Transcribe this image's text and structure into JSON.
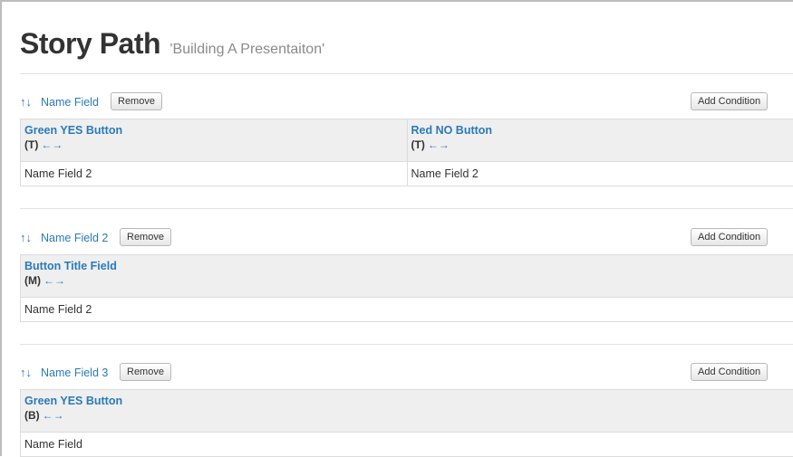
{
  "page": {
    "title": "Story Path",
    "subtitle": "'Building A Presentaiton'"
  },
  "icons": {
    "up_down": "↑↓",
    "left_right": "←→"
  },
  "sections": [
    {
      "name": "Name Field",
      "remove_label": "Remove",
      "add_condition_label": "Add Condition",
      "columns": [
        {
          "title": "Green YES Button",
          "tag": "(T)",
          "value": "Name Field 2"
        },
        {
          "title": "Red NO Button",
          "tag": "(T)",
          "value": "Name Field 2"
        }
      ]
    },
    {
      "name": "Name Field 2",
      "remove_label": "Remove",
      "add_condition_label": "Add Condition",
      "columns": [
        {
          "title": "Button Title Field",
          "tag": "(M)",
          "value": "Name Field 2"
        }
      ]
    },
    {
      "name": "Name Field 3",
      "remove_label": "Remove",
      "add_condition_label": "Add Condition",
      "columns": [
        {
          "title": "Green YES Button",
          "tag": "(B)",
          "value": "Name Field"
        }
      ]
    }
  ]
}
